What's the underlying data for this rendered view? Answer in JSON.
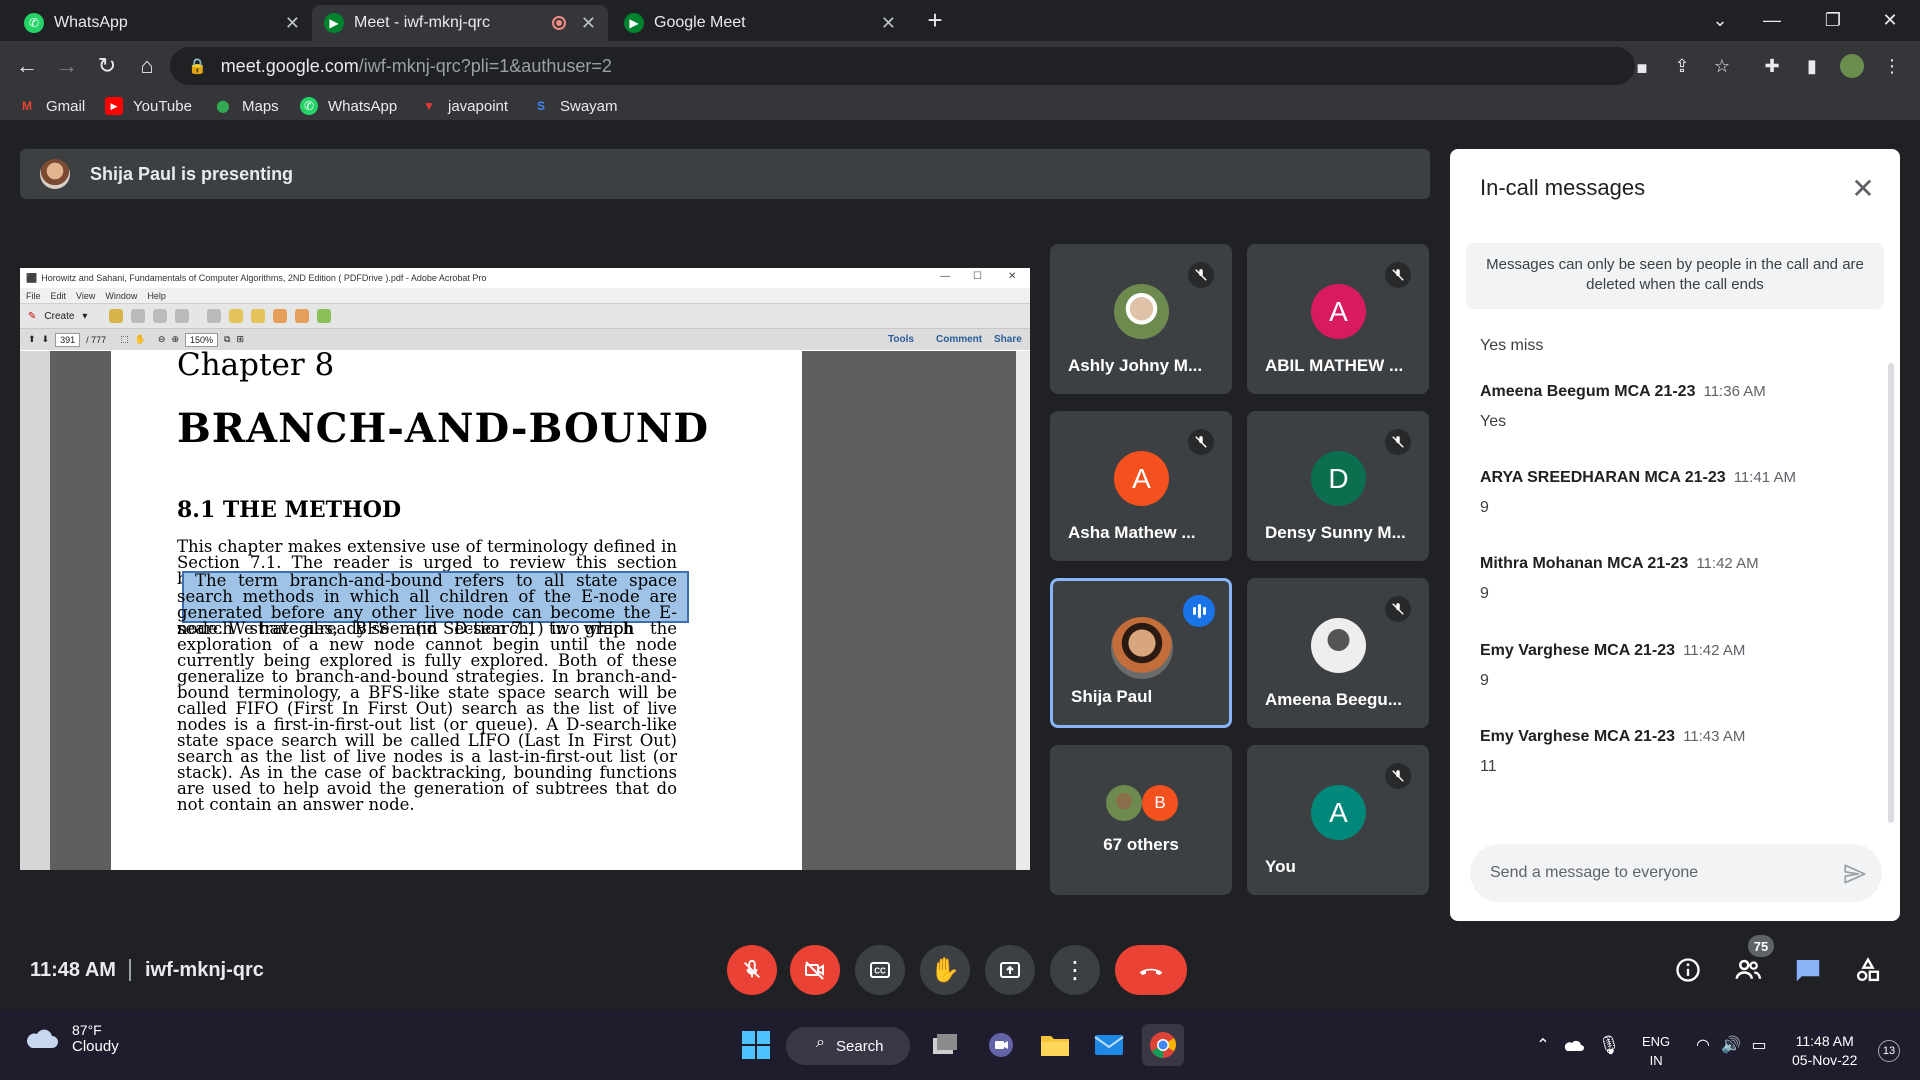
{
  "browser": {
    "tabs": [
      {
        "label": "WhatsApp"
      },
      {
        "label": "Meet - iwf-mknj-qrc"
      },
      {
        "label": "Google Meet"
      }
    ],
    "url_host": "meet.google.com",
    "url_path": "/iwf-mknj-qrc?pli=1&authuser=2",
    "bookmarks": [
      "Gmail",
      "YouTube",
      "Maps",
      "WhatsApp",
      "javapoint",
      "Swayam"
    ]
  },
  "meet": {
    "presenting_text": "Shija Paul is presenting",
    "time": "11:48 AM",
    "code": "iwf-mknj-qrc",
    "participant_count": "75",
    "participants": [
      {
        "name": "Ashly Johny M...",
        "initial": "",
        "color": "#6d8b4f"
      },
      {
        "name": "ABIL MATHEW ...",
        "initial": "A",
        "color": "#d81b60"
      },
      {
        "name": "Asha Mathew ...",
        "initial": "A",
        "color": "#f4511e"
      },
      {
        "name": "Densy Sunny M...",
        "initial": "D",
        "color": "#0b6e4f"
      },
      {
        "name": "Shija Paul",
        "initial": "",
        "color": "#7a4b32"
      },
      {
        "name": "Ameena Beegu...",
        "initial": "",
        "color": "#888888"
      },
      {
        "name": "67 others",
        "initial": "B",
        "color": "#f4511e"
      },
      {
        "name": "You",
        "initial": "A",
        "color": "#00897b"
      }
    ]
  },
  "shared_screen": {
    "window_title": "Horowitz and Sahani, Fundamentals of Computer Algorithms, 2ND Edition ( PDFDrive ).pdf - Adobe Acrobat Pro",
    "menu": [
      "File",
      "Edit",
      "View",
      "Window",
      "Help"
    ],
    "create_label": "Create",
    "page_number": "391",
    "page_total": "/ 777",
    "zoom": "150%",
    "tools_links": [
      "Tools",
      "Comment",
      "Share"
    ],
    "chapter": "Chapter 8",
    "chapter_title": "BRANCH-AND-BOUND",
    "section": "8.1    THE METHOD",
    "para1": "This chapter makes extensive use of terminology defined in Section 7.1. The reader is urged to review this section before proceeding.",
    "para2_highlight": "The term branch-and-bound refers to all state space search methods in which all children of the E-node are generated before any other live node can become the E-node. We have already seen (in Section 7.1) two graph",
    "para2_rest": "search strategies, BFS and D-search, in which the exploration of a new node cannot begin until the node currently being explored is fully explored. Both of these generalize to branch-and-bound strategies. In branch-and-bound terminology, a BFS-like state space search will be called FIFO (First In First Out) search as the list of live nodes is a first-in-first-out list (or queue). A D-search-like state space search will be called LIFO (Last In First Out) search as the list of live nodes is a last-in-first-out list (or stack). As in the case of backtracking, bounding functions are used to help avoid the generation of subtrees that do not contain an answer node."
  },
  "chat": {
    "title": "In-call messages",
    "notice": "Messages can only be seen by people in the call and are deleted when the call ends",
    "messages": [
      {
        "who": "",
        "time": "",
        "text": "Yes miss"
      },
      {
        "who": "Ameena Beegum MCA 21-23",
        "time": "11:36 AM",
        "text": "Yes"
      },
      {
        "who": "ARYA SREEDHARAN MCA 21-23",
        "time": "11:41 AM",
        "text": "9"
      },
      {
        "who": "Mithra Mohanan MCA 21-23",
        "time": "11:42 AM",
        "text": "9"
      },
      {
        "who": "Emy Varghese MCA 21-23",
        "time": "11:42 AM",
        "text": "9"
      },
      {
        "who": "Emy Varghese MCA 21-23",
        "time": "11:43 AM",
        "text": "11"
      }
    ],
    "input_placeholder": "Send a message to everyone"
  },
  "taskbar": {
    "temp": "87°F",
    "weather": "Cloudy",
    "search_label": "Search",
    "lang1": "ENG",
    "lang2": "IN",
    "time": "11:48 AM",
    "date": "05-Nov-22",
    "notifications": "13"
  }
}
